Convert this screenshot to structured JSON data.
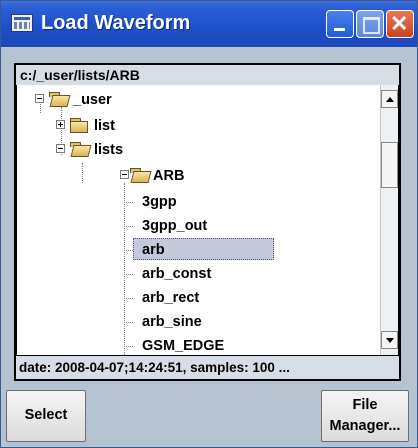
{
  "window": {
    "title": "Load Waveform",
    "title_icon": "waveform-dialog-icon",
    "controls": [
      "minimize-icon",
      "maximize-icon",
      "close-icon"
    ]
  },
  "path": "c:/_user/lists/ARB",
  "tree": {
    "nodes": [
      {
        "label": "_user",
        "type": "folder",
        "expanded": true
      },
      {
        "label": "list",
        "type": "folder",
        "expanded": false
      },
      {
        "label": "lists",
        "type": "folder",
        "expanded": true
      },
      {
        "label": "ARB",
        "type": "folder",
        "expanded": true
      },
      {
        "label": "3gpp",
        "type": "file"
      },
      {
        "label": "3gpp_out",
        "type": "file"
      },
      {
        "label": "arb",
        "type": "file",
        "selected": true
      },
      {
        "label": "arb_const",
        "type": "file"
      },
      {
        "label": "arb_rect",
        "type": "file"
      },
      {
        "label": "arb_sine",
        "type": "file"
      },
      {
        "label": "GSM_EDGE",
        "type": "file"
      }
    ]
  },
  "status": "date: 2008-04-07;14:24:51, samples: 100 ...",
  "buttons": {
    "select": "Select",
    "file_manager_line1": "File",
    "file_manager_line2": "Manager..."
  },
  "colors": {
    "titlebar": "#1e50cc",
    "dialog_bg": "#b4c2d2",
    "selection": "#c4cadc"
  }
}
